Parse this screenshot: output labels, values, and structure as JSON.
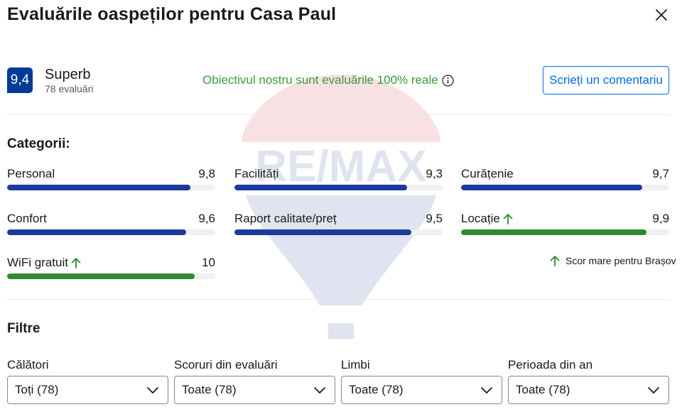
{
  "header": {
    "title": "Evaluările oaspeților pentru Casa Paul"
  },
  "summary": {
    "score": "9,4",
    "score_word": "Superb",
    "review_count": "78 evaluări",
    "objective_text": "Obiectivul nostru sunt evaluările 100% reale",
    "write_review_label": "Scrieți un comentariu"
  },
  "categories": {
    "title": "Categorii:",
    "items": [
      {
        "label": "Personal",
        "score": "9,8",
        "value": 9.8,
        "high": false
      },
      {
        "label": "Facilități",
        "score": "9,3",
        "value": 9.3,
        "high": false
      },
      {
        "label": "Curățenie",
        "score": "9,7",
        "value": 9.7,
        "high": false
      },
      {
        "label": "Confort",
        "score": "9,6",
        "value": 9.6,
        "high": false
      },
      {
        "label": "Raport calitate/preț",
        "score": "9,5",
        "value": 9.5,
        "high": false
      },
      {
        "label": "Locație",
        "score": "9,9",
        "value": 9.9,
        "high": true
      },
      {
        "label": "WiFi gratuit",
        "score": "10",
        "value": 10,
        "high": true
      }
    ],
    "high_score_note": "Scor mare pentru Brașov"
  },
  "filters": {
    "title": "Filtre",
    "items": [
      {
        "label": "Călători",
        "value": "Toți (78)"
      },
      {
        "label": "Scoruri din evaluări",
        "value": "Toate (78)"
      },
      {
        "label": "Limbi",
        "value": "Toate (78)"
      },
      {
        "label": "Perioada din an",
        "value": "Toate (78)"
      }
    ]
  },
  "watermark": {
    "brand": "RE/MAX"
  },
  "colors": {
    "badge": "#003b95",
    "bar_normal": "#1a3a9c",
    "bar_high": "#2e8b2e",
    "accent_link": "#006ce4",
    "objective_green": "#3a9c3a"
  }
}
